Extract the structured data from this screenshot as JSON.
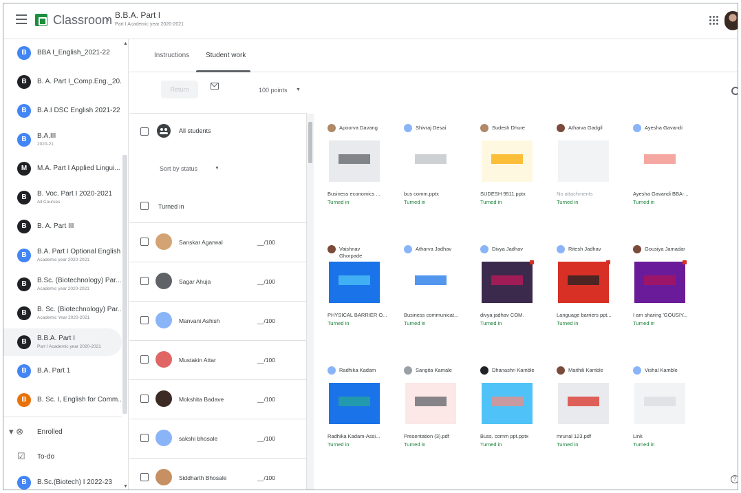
{
  "topbar": {
    "brand": "Classroom",
    "class_title": "B.B.A. Part I",
    "class_subtitle": "Part I Academic year 2020-2021"
  },
  "sidebar": {
    "courses": [
      {
        "initial": "B",
        "name": "BBA I_English_2021-22",
        "sub": "",
        "color": "#4285f4"
      },
      {
        "initial": "B",
        "name": "B. A. Part I_Comp.Eng._20...",
        "sub": "",
        "color": "#202124"
      },
      {
        "initial": "B",
        "name": "B.A.I DSC English 2021-22",
        "sub": "",
        "color": "#4285f4"
      },
      {
        "initial": "B",
        "name": "B.A.III",
        "sub": "2020-21",
        "color": "#4285f4"
      },
      {
        "initial": "M",
        "name": "M.A. Part I Applied Lingui...",
        "sub": "",
        "color": "#202124"
      },
      {
        "initial": "B",
        "name": "B. Voc. Part I 2020-2021",
        "sub": "All Courses",
        "color": "#202124"
      },
      {
        "initial": "B",
        "name": "B. A. Part III",
        "sub": "",
        "color": "#202124"
      },
      {
        "initial": "B",
        "name": "B.A. Part I Optional English",
        "sub": "Academic year 2020-2021",
        "color": "#4285f4"
      },
      {
        "initial": "B",
        "name": "B.Sc. (Biotechnology) Par...",
        "sub": "Academic year 2020-2021",
        "color": "#202124"
      },
      {
        "initial": "B",
        "name": "B. Sc. (Biotechnology) Par...",
        "sub": "Academic Year 2020-2021",
        "color": "#202124"
      },
      {
        "initial": "B",
        "name": "B.B.A. Part I",
        "sub": "Part I Academic year 2020-2021",
        "color": "#202124"
      },
      {
        "initial": "B",
        "name": "B.A. Part 1",
        "sub": "",
        "color": "#4285f4"
      },
      {
        "initial": "B",
        "name": "B. Sc. I, English for Comm...",
        "sub": "",
        "color": "#e8710a"
      }
    ],
    "enrolled": "Enrolled",
    "todo": "To-do",
    "last_course": {
      "initial": "B",
      "name": "B.Sc.(Biotech) I 2022-23",
      "color": "#4285f4"
    }
  },
  "tabs": {
    "instructions": "Instructions",
    "student_work": "Student work"
  },
  "toolbar": {
    "return_label": "Return",
    "points": "100 points"
  },
  "roster": {
    "all_students": "All students",
    "sort_by": "Sort by status",
    "group": "Turned in",
    "students": [
      {
        "name": "Sanskar Agarwal",
        "grade": "__/100",
        "avatar": "#d4a373"
      },
      {
        "name": "Sagar Ahuja",
        "grade": "__/100",
        "avatar": "#5f6368"
      },
      {
        "name": "Manvani Ashish",
        "grade": "__/100",
        "avatar": "#8ab4f8"
      },
      {
        "name": "Mustakin Attar",
        "grade": "__/100",
        "avatar": "#e06666"
      },
      {
        "name": "Mokshita Badave",
        "grade": "__/100",
        "avatar": "#3c2a24"
      },
      {
        "name": "sakshi bhosale",
        "grade": "__/100",
        "avatar": "#8ab4f8"
      },
      {
        "name": "Siddharth Bhosale",
        "grade": "__/100",
        "avatar": "#c69063"
      }
    ]
  },
  "cards": [
    {
      "name": "Apoorva Davang",
      "name2": "",
      "file": "Business economics ...",
      "status": "Turned in",
      "avatar": "#b08968",
      "thumb": "#e8eaed",
      "accent": "#5f6368",
      "dot": false
    },
    {
      "name": "Shivraj Desai",
      "name2": "",
      "file": "bus comm.pptx",
      "status": "Turned in",
      "avatar": "#8ab4f8",
      "thumb": "#ffffff",
      "accent": "#bdc1c6",
      "dot": false
    },
    {
      "name": "Sudesh Dhure",
      "name2": "",
      "file": "SUDESH 9511.pptx",
      "status": "Turned in",
      "avatar": "#b08968",
      "thumb": "#fff8e1",
      "accent": "#f9ab00",
      "dot": false
    },
    {
      "name": "Atharva Gadgil",
      "name2": "",
      "file": "No attachments",
      "status": "Turned in",
      "avatar": "#7a4b3a",
      "thumb": "#f1f3f4",
      "accent": "#f1f3f4",
      "dot": false
    },
    {
      "name": "Ayesha Gavandi",
      "name2": "",
      "file": "Ayesha Gavandi BBA-...",
      "status": "Turned in",
      "avatar": "#8ab4f8",
      "thumb": "#ffffff",
      "accent": "#f28b82",
      "dot": false
    },
    {
      "name": "Vaishnav",
      "name2": "Ghorpade",
      "file": "PHYSICAL BARRIER O...",
      "status": "Turned in",
      "avatar": "#7a4b3a",
      "thumb": "#1a73e8",
      "accent": "#4fc3f7",
      "dot": false
    },
    {
      "name": "Atharva Jadhav",
      "name2": "",
      "file": "Business communicat...",
      "status": "Turned in",
      "avatar": "#8ab4f8",
      "thumb": "#ffffff",
      "accent": "#1a73e8",
      "dot": false
    },
    {
      "name": "Divya Jadhav",
      "name2": "",
      "file": "divya jadhav COM.",
      "status": "Turned in",
      "avatar": "#8ab4f8",
      "thumb": "#3c2a4d",
      "accent": "#c2185b",
      "dot": true
    },
    {
      "name": "Ritesh Jadhav",
      "name2": "",
      "file": "Language barriers ppt...",
      "status": "Turned in",
      "avatar": "#8ab4f8",
      "thumb": "#d93025",
      "accent": "#202124",
      "dot": true
    },
    {
      "name": "Gousiya Jamadar",
      "name2": "",
      "file": "I am sharing 'GOUSIY...",
      "status": "Turned in",
      "avatar": "#7a4b3a",
      "thumb": "#6a1b9a",
      "accent": "#ad1457",
      "dot": true
    },
    {
      "name": "Radhika Kadam",
      "name2": "",
      "file": "Radhika Kadam-Assi...",
      "status": "Turned in",
      "avatar": "#8ab4f8",
      "thumb": "#1a73e8",
      "accent": "#26a69a",
      "dot": false
    },
    {
      "name": "Sangita Kamale",
      "name2": "",
      "file": "Presentation (3).pdf",
      "status": "Turned in",
      "avatar": "#9aa0a6",
      "thumb": "#fce8e6",
      "accent": "#5f6368",
      "dot": false
    },
    {
      "name": "Dhanashri Kamble",
      "name2": "",
      "file": "Buss. comm ppt.pptx",
      "status": "Turned in",
      "avatar": "#202124",
      "thumb": "#4fc3f7",
      "accent": "#f28b82",
      "dot": false
    },
    {
      "name": "Maithili Kamble",
      "name2": "",
      "file": "mrunal 123.pdf",
      "status": "Turned in",
      "avatar": "#7a4b3a",
      "thumb": "#e8eaed",
      "accent": "#d93025",
      "dot": false
    },
    {
      "name": "Vishal Kamble",
      "name2": "",
      "file": "Link",
      "status": "Turned in",
      "avatar": "#8ab4f8",
      "thumb": "#f1f3f4",
      "accent": "#dadce0",
      "dot": false
    }
  ]
}
